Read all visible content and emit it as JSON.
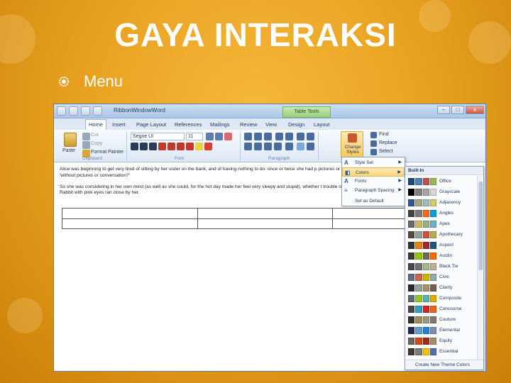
{
  "slide": {
    "title": "GAYA INTERAKSI",
    "bullet": "Menu"
  },
  "window": {
    "title": "RibbonWindowWord",
    "context_tab": "Table Tools",
    "controls": [
      "–",
      "□",
      "x"
    ]
  },
  "tabs": [
    "Home",
    "Insert",
    "Page Layout",
    "References",
    "Mailings",
    "Review",
    "View",
    "Design",
    "Layout"
  ],
  "ribbon": {
    "clipboard": {
      "paste": "Paste",
      "cut": "Cut",
      "copy": "Copy",
      "format_painter": "Format Painter",
      "label": "Clipboard"
    },
    "font": {
      "name": "Segoe UI",
      "size": "11",
      "label": "Font"
    },
    "paragraph": {
      "label": "Paragraph"
    },
    "styles": {
      "change_styles": "Change Styles"
    },
    "editing": {
      "find": "Find",
      "replace": "Replace",
      "select": "Select"
    }
  },
  "document": {
    "para1": "Alice was beginning to get very tired of sitting by her sister on the bank, and of having nothing to do: once or twice she had p pictures or conversations in it, 'and what is the use of a book,' thought Alice 'without pictures or conversation?'",
    "para2": "So she was considering in her own mind (as well as she could, for the hot day made her feel very sleepy and stupid), whether t trouble of getting up and picking the daisies, when suddenly a White Rabbit with pink eyes ran close by her."
  },
  "styles_menu": {
    "items": [
      {
        "label": "Style Set",
        "icon": "A"
      },
      {
        "label": "Colors",
        "icon": "◧"
      },
      {
        "label": "Fonts",
        "icon": "A"
      },
      {
        "label": "Paragraph Spacing",
        "icon": "≡"
      },
      {
        "label": "Set as Default",
        "icon": ""
      }
    ]
  },
  "colors_menu": {
    "header": "Built-In",
    "footer": "Create New Theme Colors",
    "themes": [
      {
        "name": "Office",
        "swatches": [
          "#1f497d",
          "#4f81bd",
          "#c0504d",
          "#9bbb59"
        ]
      },
      {
        "name": "Grayscale",
        "swatches": [
          "#000000",
          "#808080",
          "#a6a6a6",
          "#d9d9d9"
        ]
      },
      {
        "name": "Adjacency",
        "swatches": [
          "#2f5897",
          "#a9a57c",
          "#9cbebd",
          "#d2cb6c"
        ]
      },
      {
        "name": "Angles",
        "swatches": [
          "#434342",
          "#797b7e",
          "#f96a1b",
          "#08a1d9"
        ]
      },
      {
        "name": "Apex",
        "swatches": [
          "#69676d",
          "#ceb966",
          "#9cb084",
          "#6bb1c9"
        ]
      },
      {
        "name": "Apothecary",
        "swatches": [
          "#564b3c",
          "#93a299",
          "#cf543f",
          "#b5ae53"
        ]
      },
      {
        "name": "Aspect",
        "swatches": [
          "#323232",
          "#f07f09",
          "#9f2936",
          "#1b587c"
        ]
      },
      {
        "name": "Austin",
        "swatches": [
          "#3e3d2d",
          "#94c600",
          "#71685a",
          "#ff6700"
        ]
      },
      {
        "name": "Black Tie",
        "swatches": [
          "#46464a",
          "#6f6f74",
          "#a7b789",
          "#beae98"
        ]
      },
      {
        "name": "Civic",
        "swatches": [
          "#646b86",
          "#d16349",
          "#ccb400",
          "#8cadae"
        ]
      },
      {
        "name": "Clarity",
        "swatches": [
          "#292934",
          "#93a299",
          "#ad8f67",
          "#726056"
        ]
      },
      {
        "name": "Composite",
        "swatches": [
          "#5b6973",
          "#98c723",
          "#59b0b9",
          "#deae00"
        ]
      },
      {
        "name": "Concourse",
        "swatches": [
          "#464646",
          "#2da2bf",
          "#da1f28",
          "#eb641b"
        ]
      },
      {
        "name": "Couture",
        "swatches": [
          "#37302a",
          "#9e8e5c",
          "#a09781",
          "#85776d"
        ]
      },
      {
        "name": "Elemental",
        "swatches": [
          "#242852",
          "#629dd1",
          "#297fd5",
          "#7f8fa9"
        ]
      },
      {
        "name": "Equity",
        "swatches": [
          "#696464",
          "#d34817",
          "#9b2d1f",
          "#a28e6a"
        ]
      },
      {
        "name": "Essential",
        "swatches": [
          "#40382a",
          "#7a7a7a",
          "#f5c201",
          "#526db0"
        ]
      }
    ]
  }
}
